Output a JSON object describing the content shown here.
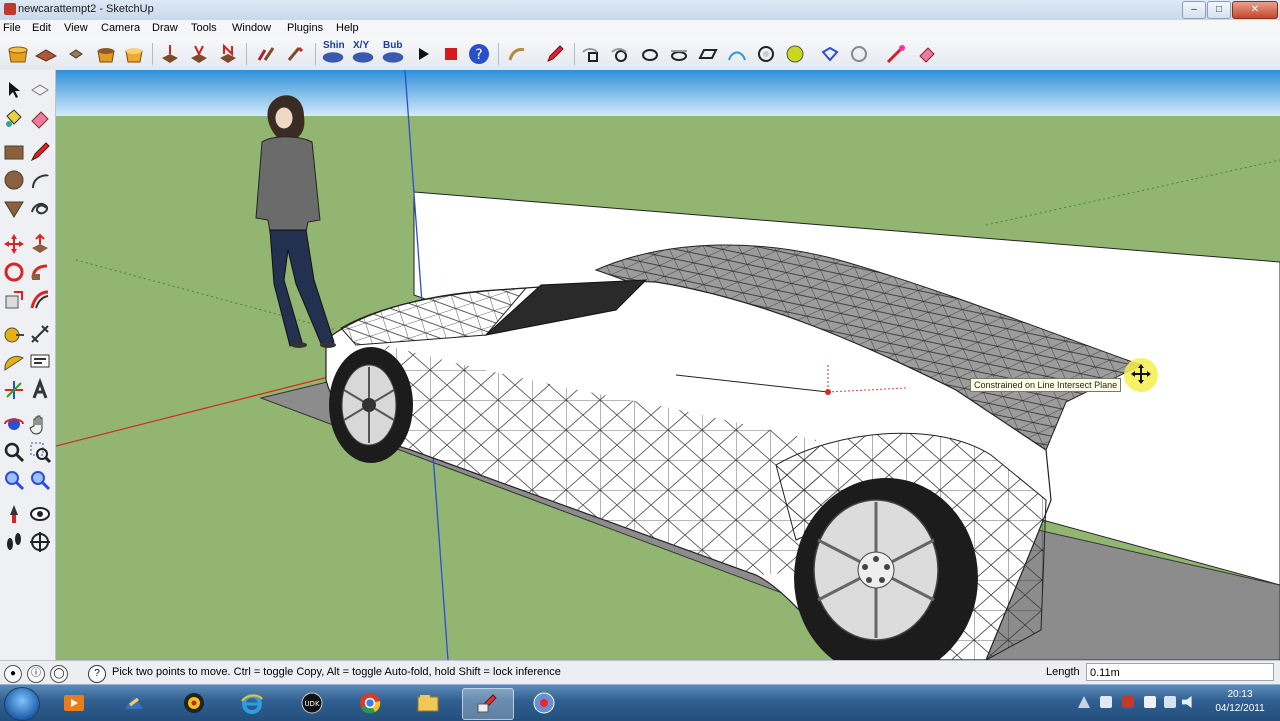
{
  "window": {
    "title": "newcarattempt2 - SketchUp"
  },
  "menu": [
    "File",
    "Edit",
    "View",
    "Camera",
    "Draw",
    "Tools",
    "Window",
    "Plugins",
    "Help"
  ],
  "toolbar": {
    "icons": [
      "get-models-icon",
      "share-model-icon",
      "component-icon",
      "sandbox-from-contours-icon",
      "sandbox-from-scratch-icon",
      "add-axis-j-icon",
      "add-axis-v-icon",
      "add-axis-n-icon",
      "flip-icon",
      "flip-along-icon",
      "shin-label",
      "xyz-label",
      "bub-label",
      "play-icon",
      "stop-icon",
      "help-icon",
      "lasso-icon",
      "pencil-icon"
    ],
    "plugin_labels": {
      "shin": "Shin",
      "xyz": "X/Y",
      "bub": "Bub"
    }
  },
  "viewport": {
    "tooltip": "Constrained on Line Intersect Plane"
  },
  "status": {
    "hint": "Pick two points to move.  Ctrl = toggle Copy, Alt = toggle Auto-fold, hold Shift = lock inference",
    "measurement_label": "Length",
    "measurement_value": "0.11m"
  },
  "tray": {
    "time": "20:13",
    "date": "04/12/2011"
  },
  "colors": {
    "sky": "#bfe0f7",
    "ground": "#93b874",
    "red_axis": "#d03020",
    "blue_axis": "#2a4fd6"
  }
}
